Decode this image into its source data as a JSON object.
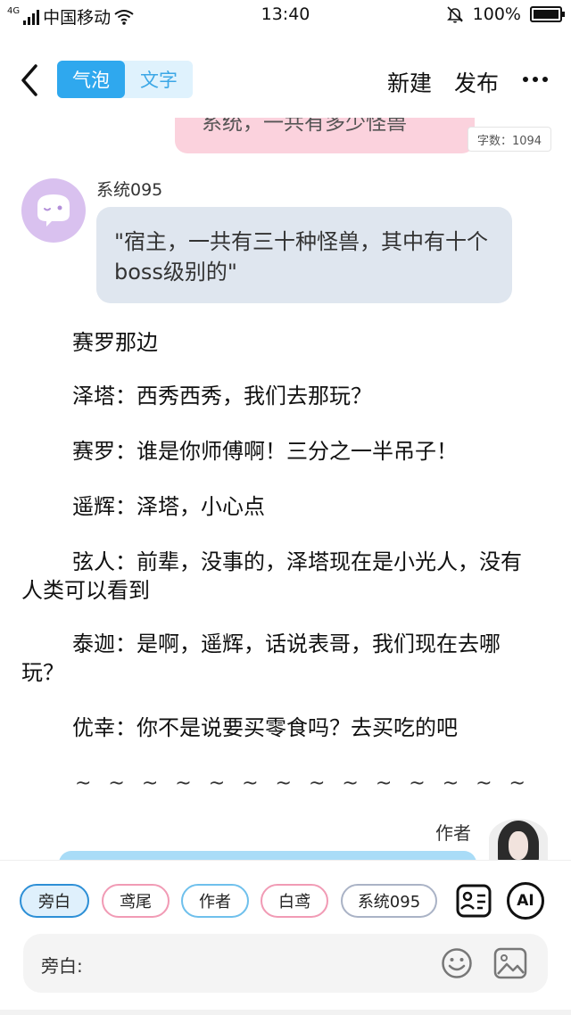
{
  "status_bar": {
    "network": "4G",
    "carrier": "中国移动",
    "time": "13:40",
    "battery": "100%",
    "battery_level": 1.0
  },
  "header": {
    "tab_bubble": "气泡",
    "tab_text": "文字",
    "new_label": "新建",
    "publish_label": "发布"
  },
  "story": {
    "prev_bubble_text": "系统，一共有多少怪兽",
    "word_count": "字数：1094",
    "system_name": "系统095",
    "system_message": "\"宿主，一共有三十种怪兽，其中有十个boss级别的\"",
    "narration": [
      "赛罗那边",
      "泽塔：西秀西秀，我们去那玩？",
      "赛罗：谁是你师傅啊！三分之一半吊子！",
      "遥辉：泽塔，小心点",
      "弦人：前辈，没事的，泽塔现在是小光人，没有人类可以看到",
      "泰迦：是啊，遥辉，话说表哥，我们现在去哪玩？",
      "优幸：你不是说要买零食吗？去买吃的吧"
    ],
    "divider": "~ ~ ~ ~ ~ ~ ~ ~ ~ ~ ~ ~ ~ ~",
    "author_name": "作者"
  },
  "roles": [
    {
      "label": "旁白",
      "color": "#2d8fd6",
      "active": true
    },
    {
      "label": "鸢尾",
      "color": "#f19bb5",
      "active": false
    },
    {
      "label": "作者",
      "color": "#6fc0ec",
      "active": false
    },
    {
      "label": "白鸢",
      "color": "#f19bb5",
      "active": false
    },
    {
      "label": "系统095",
      "color": "#aab3c6",
      "active": false
    }
  ],
  "ai_label": "AI",
  "input": {
    "label": "旁白:"
  },
  "colors": {
    "accent": "#2fa8ee",
    "pink_bubble": "#fbd2dd",
    "grey_bubble": "#dfe6ef",
    "blue_bubble": "#a9dcf7",
    "system_avatar": "#d9c1ef"
  },
  "icons": [
    "back-icon",
    "more-icon",
    "ghost-avatar-icon",
    "contact-card-icon",
    "emoji-icon",
    "image-icon"
  ]
}
